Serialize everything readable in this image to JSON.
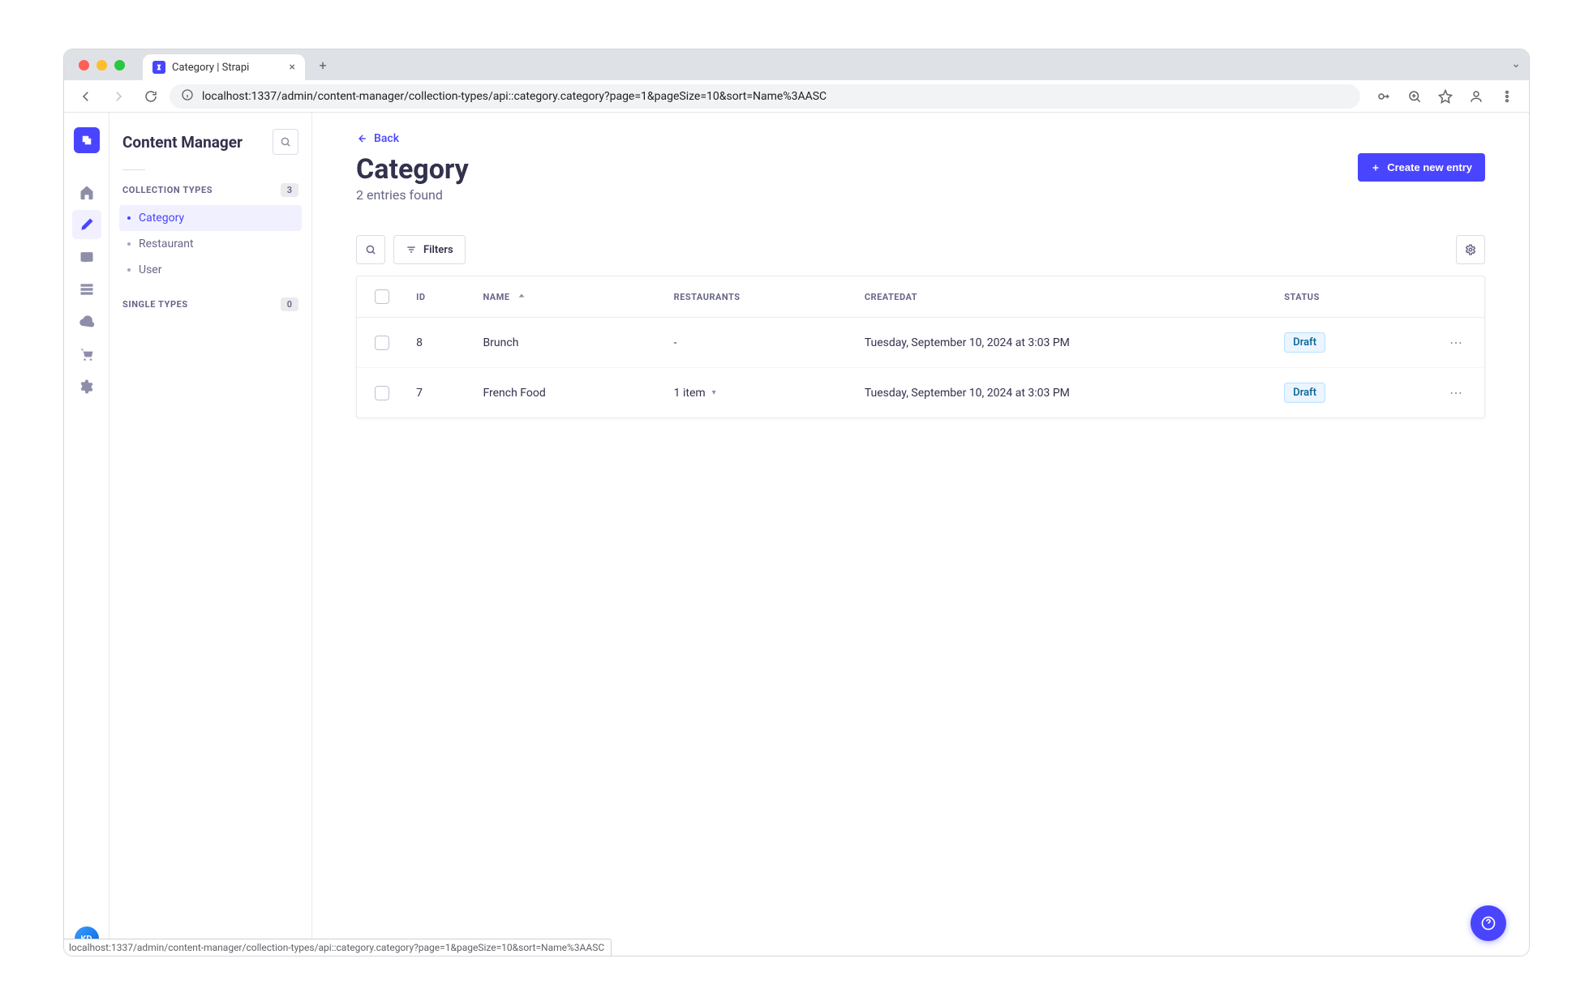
{
  "browser": {
    "tab_title": "Category | Strapi",
    "url": "localhost:1337/admin/content-manager/collection-types/api::category.category?page=1&pageSize=10&sort=Name%3AASC",
    "status_bar_url": "localhost:1337/admin/content-manager/collection-types/api::category.category?page=1&pageSize=10&sort=Name%3AASC"
  },
  "rail": {
    "avatar_initials": "KD"
  },
  "sidebar": {
    "title": "Content Manager",
    "groups": [
      {
        "label": "COLLECTION TYPES",
        "count": "3",
        "items": [
          {
            "label": "Category",
            "active": true
          },
          {
            "label": "Restaurant",
            "active": false
          },
          {
            "label": "User",
            "active": false
          }
        ]
      },
      {
        "label": "SINGLE TYPES",
        "count": "0",
        "items": []
      }
    ]
  },
  "main": {
    "back_label": "Back",
    "page_title": "Category",
    "subtitle": "2 entries found",
    "create_button": "Create new entry",
    "filters_label": "Filters",
    "columns": {
      "id": "ID",
      "name": "NAME",
      "restaurants": "RESTAURANTS",
      "createdat": "CREATEDAT",
      "status": "STATUS"
    },
    "rows": [
      {
        "id": "8",
        "name": "Brunch",
        "restaurants": "-",
        "rest_has_caret": false,
        "createdat": "Tuesday, September 10, 2024 at 3:03 PM",
        "status": "Draft"
      },
      {
        "id": "7",
        "name": "French Food",
        "restaurants": "1 item",
        "rest_has_caret": true,
        "createdat": "Tuesday, September 10, 2024 at 3:03 PM",
        "status": "Draft"
      }
    ]
  }
}
